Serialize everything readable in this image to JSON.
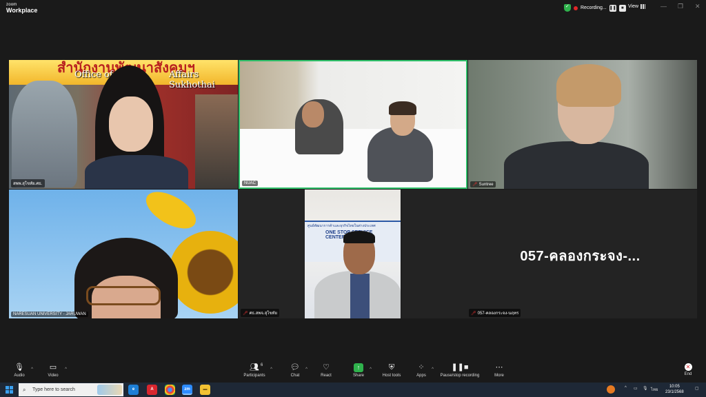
{
  "app": {
    "brand_small": "zoom",
    "brand_big": "Workplace"
  },
  "recording": {
    "label": "Recording...",
    "pause": "❚❚",
    "stop": "■"
  },
  "view_label": "View",
  "window_controls": {
    "minimize": "—",
    "restore": "❐",
    "close": "✕"
  },
  "tiles": [
    {
      "name": "สพพ.สุโขทัย.ศธ.",
      "banner_text": "สำนักงานพัฒนาสังคมฯ",
      "sub_left": "Office of",
      "sub_right": "Affairs Sukhothai"
    },
    {
      "name": "NUAC"
    },
    {
      "name": "Suntree"
    },
    {
      "name": "NARESUAN UNIVERSITY - JARUWAN"
    },
    {
      "name": "ศธ.สพจ.สุโขทัย",
      "sign_text": "ศูนย์พัฒนาการค้าและธุรกิจไทยในต่างประเทศ",
      "sign_big": "ONE STOP SERVICE CENTER"
    },
    {
      "name": "057-คลองกระจง-นฤทร",
      "display": "057-คลองกระจง-..."
    }
  ],
  "toolbar": {
    "audio": "Audio",
    "video": "Video",
    "participants": "Participants",
    "participants_count": "6",
    "chat": "Chat",
    "react": "React",
    "share": "Share",
    "host_tools": "Host tools",
    "apps": "Apps",
    "pause_stop_recording": "Pause/stop recording",
    "more": "More",
    "end": "End"
  },
  "taskbar": {
    "search_placeholder": "Type here to search",
    "apps": [
      "edge",
      "acrobat",
      "chrome",
      "zoom",
      "file-explorer"
    ],
    "lang": "ไทย",
    "time": "10:05",
    "date": "23/1/2568"
  },
  "colors": {
    "active_speaker": "#2fc16a",
    "share": "#2fb24c",
    "end": "#d8262e",
    "recording_dot": "#e02828"
  }
}
